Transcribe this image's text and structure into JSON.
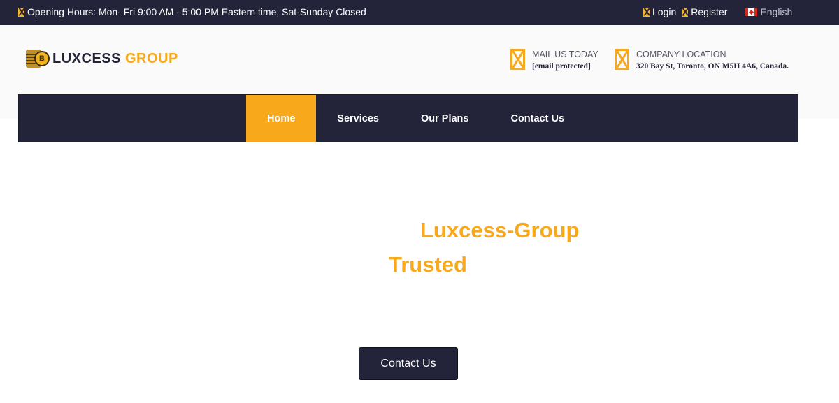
{
  "topbar": {
    "hours_text": "Opening Hours: Mon- Fri 9:00 AM - 5:00 PM Eastern time, Sat-Sunday Closed",
    "login_label": "Login",
    "register_label": "Register",
    "language_label": "English"
  },
  "header": {
    "logo_part1": "LUXCESS",
    "logo_part2": "GROUP",
    "logo_coin_letter": "B",
    "mail_title": "MAIL US TODAY",
    "mail_value": "[email protected]",
    "location_title": "COMPANY LOCATION",
    "location_value": "320 Bay St, Toronto, ON M5H 4A6, Canada."
  },
  "nav": {
    "items": [
      {
        "label": "Home",
        "active": true
      },
      {
        "label": "Services",
        "active": false
      },
      {
        "label": "Our Plans",
        "active": false
      },
      {
        "label": "Contact Us",
        "active": false
      }
    ]
  },
  "hero": {
    "line1": "Luxcess-Group",
    "line2": "Trusted",
    "cta_label": "Contact Us"
  },
  "colors": {
    "navy": "#232439",
    "accent": "#f7a91b"
  }
}
